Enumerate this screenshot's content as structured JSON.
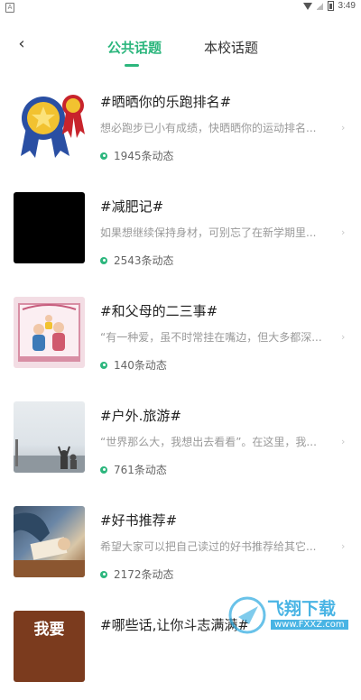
{
  "status_bar": {
    "time": "3:49"
  },
  "header": {
    "back_glyph": "‹",
    "tabs": [
      {
        "label": "公共话题",
        "active": true
      },
      {
        "label": "本校话题",
        "active": false
      }
    ]
  },
  "topics": [
    {
      "title": "#晒晒你的乐跑排名#",
      "desc": "想必跑步已小有成绩，快晒晒你的运动排名...",
      "count": "1945条动态",
      "thumb": "medal-ribbon-image"
    },
    {
      "title": "#减肥记#",
      "desc": "如果想继续保持身材，可别忘了在新学期里...",
      "count": "2543条动态",
      "thumb": "black-image"
    },
    {
      "title": "#和父母的二三事#",
      "desc": "“有一种爱，虽不时常挂在嘴边，但大多都深...",
      "count": "140条动态",
      "thumb": "family-illustration"
    },
    {
      "title": "#户外.旅游#",
      "desc": "“世界那么大，我想出去看看”。在这里，我...",
      "count": "761条动态",
      "thumb": "travel-photo"
    },
    {
      "title": "#好书推荐#",
      "desc": "希望大家可以把自己读过的好书推荐给其它...",
      "count": "2172条动态",
      "thumb": "book-reading-photo"
    },
    {
      "title": "#哪些话,让你斗志满满#",
      "desc": "",
      "count": "",
      "thumb": "wo-yao-sign-image",
      "thumb_text": "我要"
    }
  ],
  "watermark": {
    "text": "飞翔下载",
    "url": "www.FXXZ.com"
  },
  "colors": {
    "accent": "#2cb67d",
    "text": "#222222",
    "muted": "#9a9a9a"
  },
  "icons": {
    "chevron": "›"
  }
}
